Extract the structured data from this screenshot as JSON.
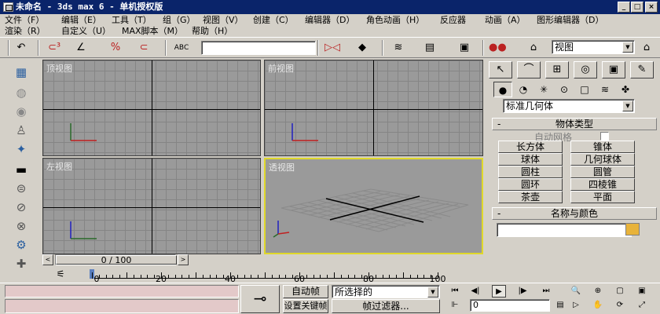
{
  "title_bar": {
    "title": "未命名 - 3ds max 6 - 单机授权版",
    "minimize": "_",
    "maximize": "□",
    "close": "×"
  },
  "menu_row1": [
    "文件（F）",
    "编辑（E）",
    "工具（T）",
    "组（G）",
    "视图（V）",
    "创建（C）",
    "编辑器（D）",
    "角色动画（H）",
    "反应器",
    "动画（A）",
    "图形编辑器（D）"
  ],
  "menu_row2": [
    "渲染（R）",
    "自定义（U）",
    "MAX脚本（M）",
    "帮助（H）"
  ],
  "toolbar": {
    "view_combo": "视图",
    "selection_combo": ""
  },
  "viewports": [
    {
      "label": "顶视图"
    },
    {
      "label": "前视图"
    },
    {
      "label": "左视图"
    },
    {
      "label": "透视图"
    }
  ],
  "time_slider": {
    "frame_text": "0 / 100",
    "prev": "<",
    "next": ">"
  },
  "track_bar": {
    "ticks": [
      "0",
      "20",
      "40",
      "60",
      "80",
      "100"
    ]
  },
  "command_panel": {
    "category": "标准几何体",
    "object_type_title": "物体类型",
    "autogrid_label": "自动网格",
    "objects": [
      "长方体",
      "锥体",
      "球体",
      "几何球体",
      "圆柱",
      "圆管",
      "圆环",
      "四棱锥",
      "茶壶",
      "平面"
    ],
    "name_color_title": "名称与颜色",
    "name_value": "",
    "color_swatch": "#e8b33a"
  },
  "bottom": {
    "auto_key": "自动帧",
    "set_key": "设置关键帧",
    "selection_filter": "所选择的",
    "key_filters": "帧过滤器...",
    "frame_field": "0"
  },
  "colors": {
    "title_bar": "#0a246a",
    "viewport_bg": "#9a9a9a",
    "active_viewport_border": "#e0d82a",
    "status_field": "#e3c9c9"
  }
}
